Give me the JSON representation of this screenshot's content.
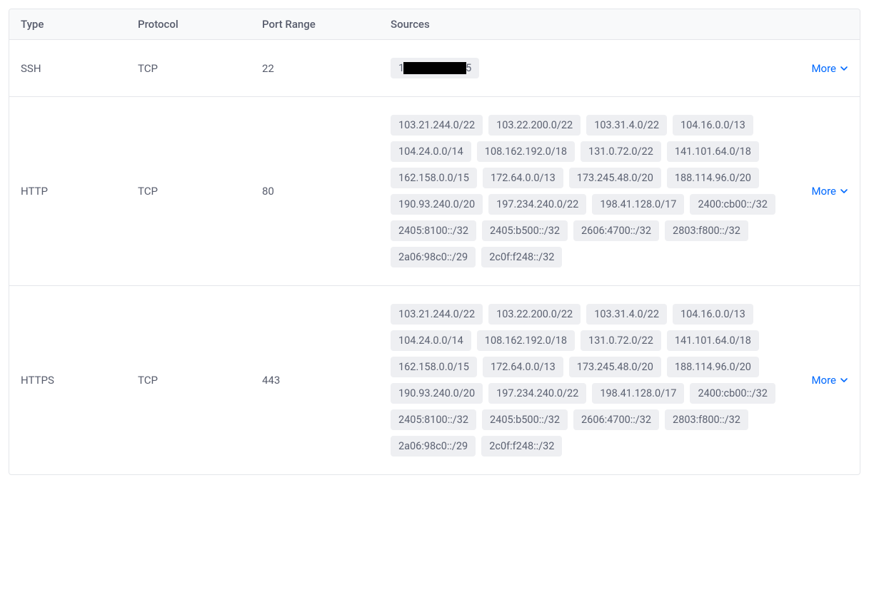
{
  "headers": {
    "type": "Type",
    "protocol": "Protocol",
    "port": "Port Range",
    "sources": "Sources"
  },
  "moreLabel": "More",
  "rows": [
    {
      "type": "SSH",
      "protocol": "TCP",
      "port": "22",
      "sources": [],
      "redacted": {
        "prefix": "1",
        "suffix": "5"
      }
    },
    {
      "type": "HTTP",
      "protocol": "TCP",
      "port": "80",
      "sources": [
        "103.21.244.0/22",
        "103.22.200.0/22",
        "103.31.4.0/22",
        "104.16.0.0/13",
        "104.24.0.0/14",
        "108.162.192.0/18",
        "131.0.72.0/22",
        "141.101.64.0/18",
        "162.158.0.0/15",
        "172.64.0.0/13",
        "173.245.48.0/20",
        "188.114.96.0/20",
        "190.93.240.0/20",
        "197.234.240.0/22",
        "198.41.128.0/17",
        "2400:cb00::/32",
        "2405:8100::/32",
        "2405:b500::/32",
        "2606:4700::/32",
        "2803:f800::/32",
        "2a06:98c0::/29",
        "2c0f:f248::/32"
      ]
    },
    {
      "type": "HTTPS",
      "protocol": "TCP",
      "port": "443",
      "sources": [
        "103.21.244.0/22",
        "103.22.200.0/22",
        "103.31.4.0/22",
        "104.16.0.0/13",
        "104.24.0.0/14",
        "108.162.192.0/18",
        "131.0.72.0/22",
        "141.101.64.0/18",
        "162.158.0.0/15",
        "172.64.0.0/13",
        "173.245.48.0/20",
        "188.114.96.0/20",
        "190.93.240.0/20",
        "197.234.240.0/22",
        "198.41.128.0/17",
        "2400:cb00::/32",
        "2405:8100::/32",
        "2405:b500::/32",
        "2606:4700::/32",
        "2803:f800::/32",
        "2a06:98c0::/29",
        "2c0f:f248::/32"
      ]
    }
  ]
}
